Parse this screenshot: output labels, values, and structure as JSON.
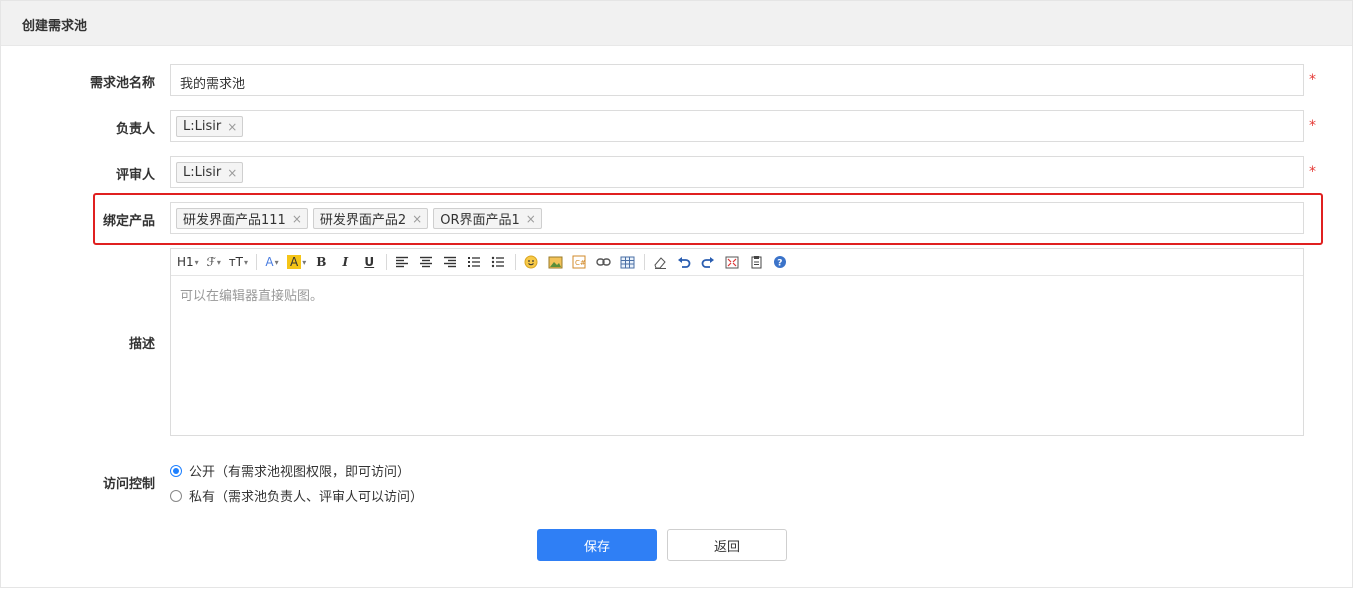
{
  "panel": {
    "title": "创建需求池"
  },
  "form": {
    "name": {
      "label": "需求池名称",
      "value": "我的需求池",
      "required": "*"
    },
    "owner": {
      "label": "负责人",
      "tags": [
        "L:Lisir"
      ],
      "required": "*"
    },
    "reviewer": {
      "label": "评审人",
      "tags": [
        "L:Lisir"
      ],
      "required": "*"
    },
    "products": {
      "label": "绑定产品",
      "tags": [
        "研发界面产品111",
        "研发界面产品2",
        "OR界面产品1"
      ]
    },
    "description": {
      "label": "描述",
      "placeholder": "可以在编辑器直接贴图。",
      "toolbar": {
        "heading": "H1",
        "font_family": "ℱ",
        "font_size": "тT",
        "font_color": "A",
        "bg_color": "A",
        "bold": "B",
        "italic": "I",
        "underline": "U"
      }
    },
    "access": {
      "label": "访问控制",
      "options": [
        {
          "label": "公开（有需求池视图权限，即可访问）",
          "checked": true
        },
        {
          "label": "私有（需求池负责人、评审人可以访问）",
          "checked": false
        }
      ]
    }
  },
  "actions": {
    "save": "保存",
    "back": "返回"
  },
  "colors": {
    "primary": "#2f7ff5",
    "required": "#e53935",
    "highlight": "#e02020"
  }
}
